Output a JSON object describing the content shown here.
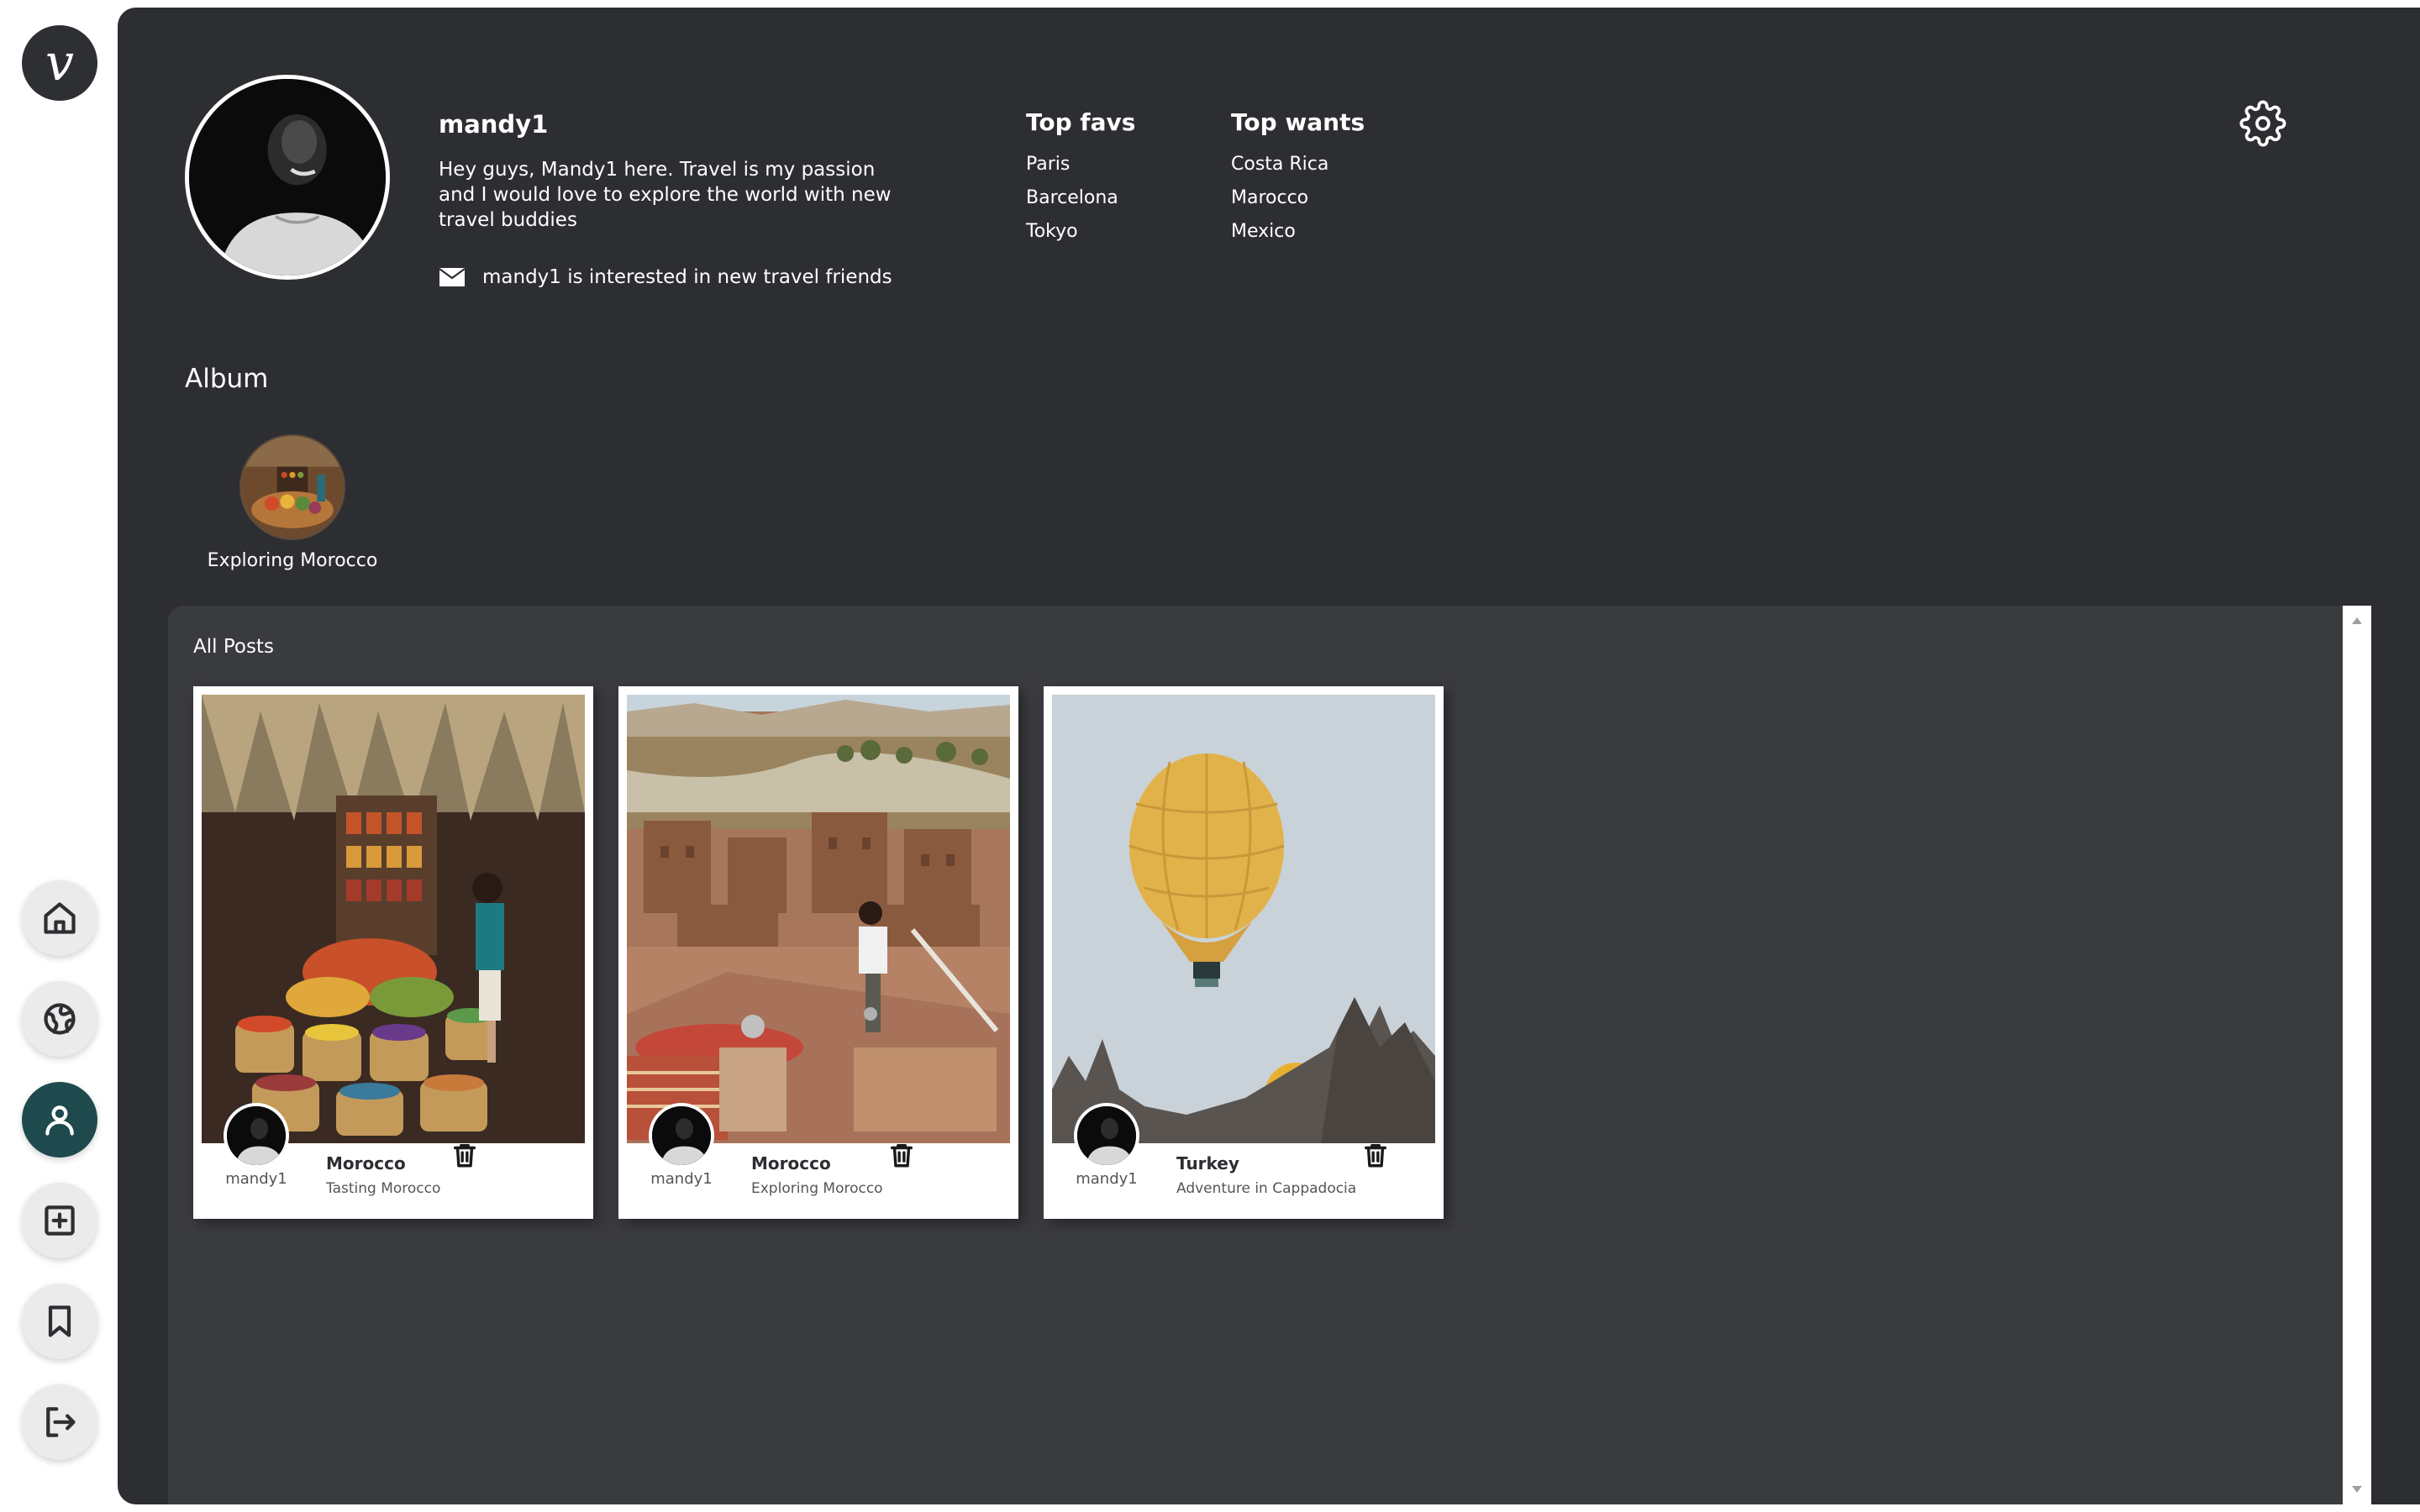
{
  "app": {
    "logo_letter": "v"
  },
  "sidebar": {
    "items": [
      {
        "name": "home",
        "icon": "home-icon",
        "active": false
      },
      {
        "name": "explore",
        "icon": "globe-icon",
        "active": false
      },
      {
        "name": "profile",
        "icon": "user-icon",
        "active": true
      },
      {
        "name": "create",
        "icon": "plus-square-icon",
        "active": false
      },
      {
        "name": "saved",
        "icon": "bookmark-icon",
        "active": false
      },
      {
        "name": "logout",
        "icon": "logout-icon",
        "active": false
      }
    ]
  },
  "profile": {
    "username": "mandy1",
    "bio": "Hey guys, Mandy1 here. Travel is my passion and I would love to explore the world with new travel buddies",
    "interest": "mandy1 is interested in new travel friends"
  },
  "top_favs": {
    "title": "Top favs",
    "items": [
      "Paris",
      "Barcelona",
      "Tokyo"
    ]
  },
  "top_wants": {
    "title": "Top wants",
    "items": [
      "Costa Rica",
      "Marocco",
      "Mexico"
    ]
  },
  "album": {
    "title": "Album",
    "items": [
      {
        "label": "Exploring Morocco"
      }
    ]
  },
  "posts": {
    "title": "All Posts",
    "items": [
      {
        "user": "mandy1",
        "country": "Morocco",
        "subtitle": "Tasting Morocco"
      },
      {
        "user": "mandy1",
        "country": "Morocco",
        "subtitle": "Exploring Morocco"
      },
      {
        "user": "mandy1",
        "country": "Turkey",
        "subtitle": "Adventure in Cappadocia"
      }
    ]
  },
  "colors": {
    "panel_bg": "#2d2e32",
    "posts_bg": "#3a3b3f",
    "active_nav": "#1e4a4e"
  }
}
